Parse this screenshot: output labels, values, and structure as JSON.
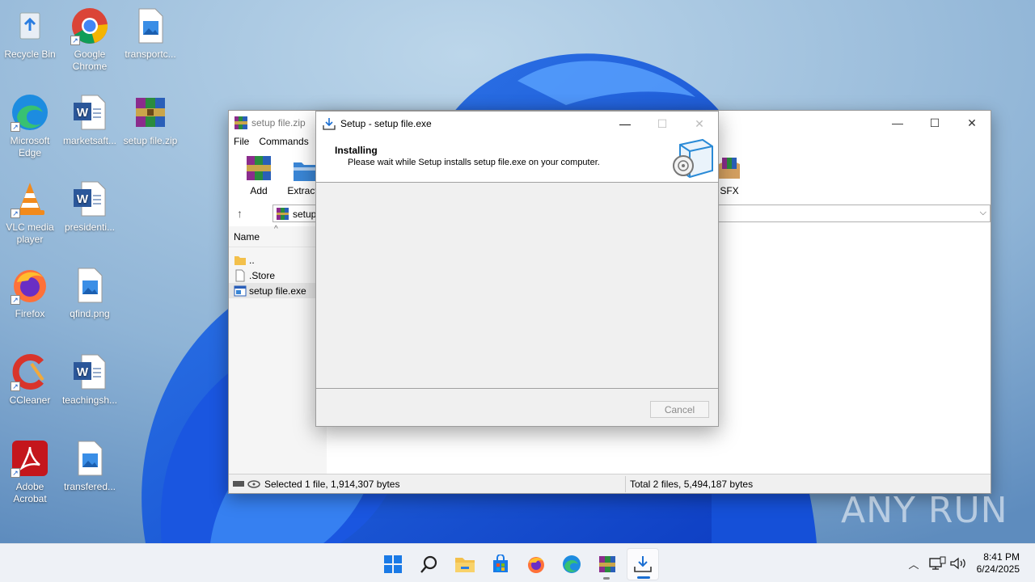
{
  "desktop": {
    "icons": [
      {
        "label": "Recycle Bin",
        "icon": "recycle-bin-icon"
      },
      {
        "label": "Google Chrome",
        "icon": "chrome-icon"
      },
      {
        "label": "transportc...",
        "icon": "image-file-icon"
      },
      {
        "label": "Microsoft Edge",
        "icon": "edge-icon"
      },
      {
        "label": "marketsaft...",
        "icon": "word-doc-icon"
      },
      {
        "label": "setup file.zip",
        "icon": "winrar-archive-icon"
      },
      {
        "label": "VLC media player",
        "icon": "vlc-icon"
      },
      {
        "label": "presidenti...",
        "icon": "word-doc-icon"
      },
      {
        "label": "Firefox",
        "icon": "firefox-icon"
      },
      {
        "label": "qfind.png",
        "icon": "image-file-icon"
      },
      {
        "label": "CCleaner",
        "icon": "ccleaner-icon"
      },
      {
        "label": "teachingsh...",
        "icon": "word-doc-icon"
      },
      {
        "label": "Adobe Acrobat",
        "icon": "acrobat-icon"
      },
      {
        "label": "transfered...",
        "icon": "image-file-icon"
      }
    ]
  },
  "winrar": {
    "title": "setup file.zip",
    "menu": [
      "File",
      "Commands"
    ],
    "toolbar": {
      "add": "Add",
      "extract": "Extract",
      "sfx": "SFX"
    },
    "address": "setup",
    "column_name": "Name",
    "files": [
      {
        "name": "..",
        "icon": "folder-icon"
      },
      {
        "name": ".Store",
        "icon": "file-icon"
      },
      {
        "name": "setup file.exe",
        "icon": "exe-icon"
      }
    ],
    "status_left": "Selected 1 file, 1,914,307 bytes",
    "status_right": "Total 2 files, 5,494,187 bytes"
  },
  "setup": {
    "title": "Setup - setup file.exe",
    "heading": "Installing",
    "subtext": "Please wait while Setup installs setup file.exe on your computer.",
    "cancel": "Cancel"
  },
  "watermark": "ANY RUN",
  "taskbar": {
    "time": "8:41 PM",
    "date": "6/24/2025"
  },
  "colors": {
    "accent": "#1a6ed2",
    "wallpaper_blue": "#1e5fe6"
  }
}
